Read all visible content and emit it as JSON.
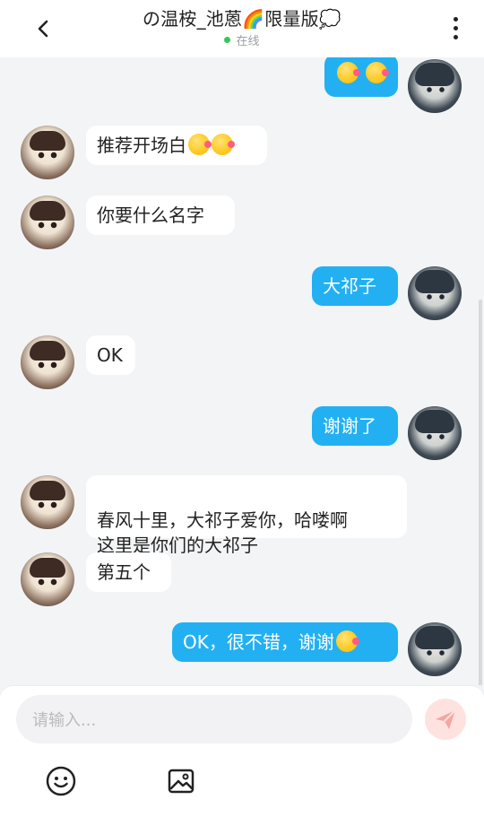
{
  "header": {
    "title": "の温桉_池蒽🌈限量版💭",
    "status": "在线"
  },
  "messages": [
    {
      "side": "out",
      "text": ""
    },
    {
      "side": "in",
      "text": "推荐开场白"
    },
    {
      "side": "in",
      "text": "你要什么名字"
    },
    {
      "side": "out",
      "text": "大祁子"
    },
    {
      "side": "in",
      "text": "OK"
    },
    {
      "side": "out",
      "text": "谢谢了"
    },
    {
      "side": "in",
      "text": "春风十里，大祁子爱你，哈喽啊\n这里是你们的大祁子"
    },
    {
      "side": "in",
      "text": "第五个"
    },
    {
      "side": "out",
      "text": "OK，很不错，谢谢"
    }
  ],
  "input": {
    "placeholder": "请输入..."
  },
  "colors": {
    "out_bubble": "#22b0f2",
    "in_bubble": "#ffffff",
    "background": "#f2f4f5",
    "online_dot": "#34c759",
    "send_button": "#fde2df",
    "send_icon": "#f4a6a0"
  },
  "icons": {
    "back": "chevron-left-icon",
    "more": "more-vertical-icon",
    "send": "paper-plane-icon",
    "emoji": "smiley-icon",
    "image": "image-icon"
  }
}
